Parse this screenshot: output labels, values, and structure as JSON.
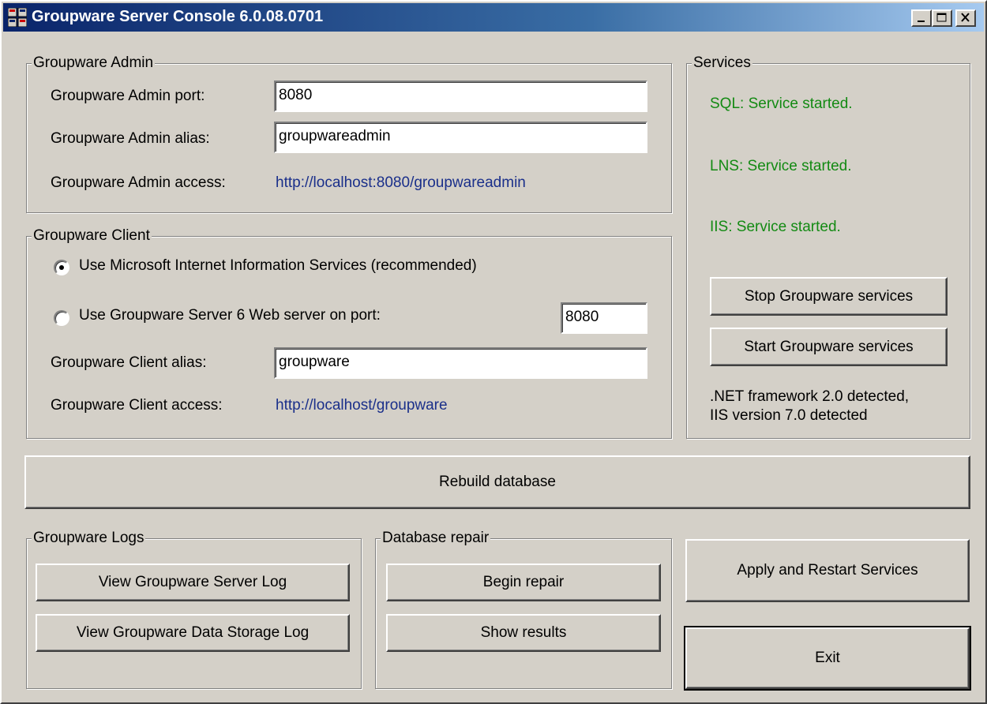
{
  "window": {
    "title": "Groupware Server Console 6.0.08.0701"
  },
  "admin": {
    "group_label": "Groupware Admin",
    "port_label": "Groupware Admin port:",
    "port_value": "8080",
    "alias_label": "Groupware Admin alias:",
    "alias_value": "groupwareadmin",
    "access_label": "Groupware Admin access:",
    "access_url": "http://localhost:8080/groupwareadmin"
  },
  "client": {
    "group_label": "Groupware Client",
    "radio_iis_label": "Use Microsoft Internet Information Services (recommended)",
    "radio_iis_selected": true,
    "radio_web_label": "Use Groupware Server 6 Web server on port:",
    "radio_web_selected": false,
    "web_port_value": "8080",
    "alias_label": "Groupware Client alias:",
    "alias_value": "groupware",
    "access_label": "Groupware Client access:",
    "access_url": "http://localhost/groupware"
  },
  "services": {
    "group_label": "Services",
    "sql_status": "SQL: Service started.",
    "lns_status": "LNS: Service started.",
    "iis_status": "IIS: Service started.",
    "stop_label": "Stop Groupware services",
    "start_label": "Start Groupware services",
    "info_line1": ".NET framework 2.0 detected,",
    "info_line2": "IIS version 7.0 detected",
    "status_color": "#138a13"
  },
  "rebuild": {
    "label": "Rebuild database"
  },
  "logs": {
    "group_label": "Groupware Logs",
    "server_log_label": "View Groupware Server Log",
    "storage_log_label": "View Groupware Data Storage Log"
  },
  "repair": {
    "group_label": "Database repair",
    "begin_label": "Begin repair",
    "results_label": "Show results"
  },
  "actions": {
    "apply_label": "Apply and Restart Services",
    "exit_label": "Exit"
  }
}
